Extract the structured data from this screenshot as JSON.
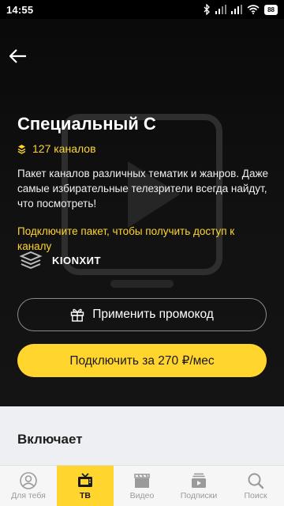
{
  "status": {
    "time": "14:55",
    "battery": "88"
  },
  "package": {
    "title": "Специальный С",
    "channels": "127 каналов",
    "description": "Пакет каналов различных тематик и жанров. Даже самые избирательные телезрители всегда найдут, что посмотреть!",
    "notice": "Подключите пакет, чтобы получить доступ к каналу",
    "brand": "KIONХИТ"
  },
  "buttons": {
    "promo": "Применить промокод",
    "connect": "Подключить за 270 ₽/мес"
  },
  "includes": {
    "title": "Включает"
  },
  "nav": {
    "items": [
      {
        "label": "Для тебя",
        "icon": "person-icon"
      },
      {
        "label": "ТВ",
        "icon": "tv-icon"
      },
      {
        "label": "Видео",
        "icon": "clapperboard-icon"
      },
      {
        "label": "Подписки",
        "icon": "subscriptions-icon"
      },
      {
        "label": "Поиск",
        "icon": "search-icon"
      }
    ],
    "active": "ТВ"
  },
  "colors": {
    "accent": "#ffd52e",
    "background": "#0f0f0f",
    "light_section": "#eeeff2"
  }
}
